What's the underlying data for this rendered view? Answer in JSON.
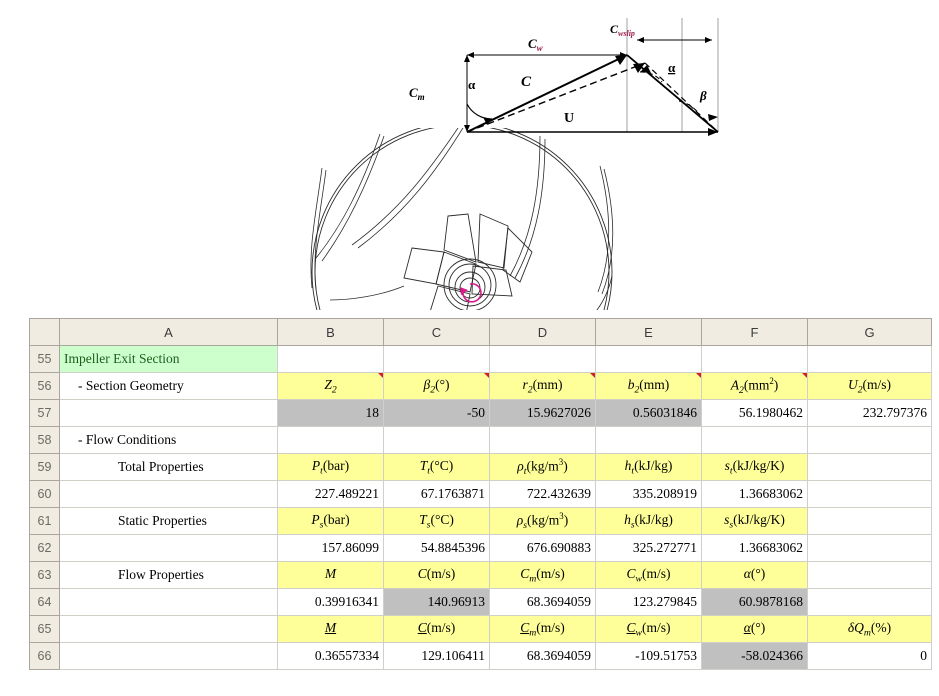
{
  "diagram": {
    "name": "impeller-exit-velocity-triangle",
    "labels": {
      "cw": "C",
      "cw_sub": "w",
      "cwslip": "C",
      "cwslip_sub": "wslip",
      "cm": "C",
      "cm_sub": "m",
      "c": "C",
      "u": "U",
      "alpha": "α",
      "alpha_underlined": "α",
      "beta": "β"
    }
  },
  "spreadsheet": {
    "columns": [
      "A",
      "B",
      "C",
      "D",
      "E",
      "F",
      "G"
    ],
    "rows": [
      {
        "n": "55",
        "a": "Impeller Exit Section",
        "a_fill": "green",
        "cells": [
          "",
          "",
          "",
          "",
          "",
          ""
        ],
        "fill": "white"
      },
      {
        "n": "56",
        "a": "- Section Geometry",
        "a_fill": "white",
        "indent": 1,
        "fill": "yellow",
        "header_row": true,
        "comments": true,
        "cells": [
          {
            "sym": "Z",
            "sub": "2",
            "unit": ""
          },
          {
            "sym": "β",
            "sub": "2",
            "unit": "(°)"
          },
          {
            "sym": "r",
            "sub": "2",
            "unit": "(mm)"
          },
          {
            "sym": "b",
            "sub": "2",
            "unit": "(mm)"
          },
          {
            "sym": "A",
            "sub": "2",
            "unit": "(mm",
            "sup": "2",
            "unit_end": ")"
          },
          {
            "sym": "U",
            "sub": "2",
            "unit": "(m/s)"
          }
        ]
      },
      {
        "n": "57",
        "a": "",
        "values": [
          "18",
          "-50",
          "15.9627026",
          "0.56031846",
          "56.1980462",
          "232.797376"
        ],
        "fills": [
          "grey",
          "grey",
          "grey",
          "grey",
          "white",
          "white"
        ]
      },
      {
        "n": "58",
        "a": "- Flow Conditions",
        "a_fill": "white",
        "indent": 1,
        "values": [
          "",
          "",
          "",
          "",
          "",
          ""
        ],
        "fills": [
          "white",
          "white",
          "white",
          "white",
          "white",
          "white"
        ]
      },
      {
        "n": "59",
        "a": "Total Properties",
        "a_fill": "white",
        "indent": 2,
        "header_row": true,
        "cells": [
          {
            "sym": "P",
            "sub": "t",
            "unit": "(bar)"
          },
          {
            "sym": "T",
            "sub": "t",
            "unit": "(°C)"
          },
          {
            "sym": "ρ",
            "sub": "t",
            "unit": "(kg/m",
            "sup": "3",
            "unit_end": ")"
          },
          {
            "sym": "h",
            "sub": "t",
            "unit": "(kJ/kg)"
          },
          {
            "sym": "s",
            "sub": "t",
            "unit": "(kJ/kg/K)"
          },
          {
            "sym": "",
            "sub": "",
            "unit": ""
          }
        ],
        "fills": [
          "yellow",
          "yellow",
          "yellow",
          "yellow",
          "yellow",
          "white"
        ]
      },
      {
        "n": "60",
        "a": "",
        "values": [
          "227.489221",
          "67.1763871",
          "722.432639",
          "335.208919",
          "1.36683062",
          ""
        ],
        "fills": [
          "white",
          "white",
          "white",
          "white",
          "white",
          "white"
        ]
      },
      {
        "n": "61",
        "a": "Static Properties",
        "a_fill": "white",
        "indent": 2,
        "header_row": true,
        "cells": [
          {
            "sym": "P",
            "sub": "s",
            "unit": "(bar)"
          },
          {
            "sym": "T",
            "sub": "s",
            "unit": "(°C)"
          },
          {
            "sym": "ρ",
            "sub": "s",
            "unit": "(kg/m",
            "sup": "3",
            "unit_end": ")"
          },
          {
            "sym": "h",
            "sub": "s",
            "unit": "(kJ/kg)"
          },
          {
            "sym": "s",
            "sub": "s",
            "unit": "(kJ/kg/K)"
          },
          {
            "sym": "",
            "sub": "",
            "unit": ""
          }
        ],
        "fills": [
          "yellow",
          "yellow",
          "yellow",
          "yellow",
          "yellow",
          "white"
        ]
      },
      {
        "n": "62",
        "a": "",
        "values": [
          "157.86099",
          "54.8845396",
          "676.690883",
          "325.272771",
          "1.36683062",
          ""
        ],
        "fills": [
          "white",
          "white",
          "white",
          "white",
          "white",
          "white"
        ]
      },
      {
        "n": "63",
        "a": "Flow Properties",
        "a_fill": "white",
        "indent": 2,
        "header_row": true,
        "cells": [
          {
            "sym": "M",
            "sub": "",
            "unit": ""
          },
          {
            "sym": "C",
            "sub": "",
            "unit": "(m/s)"
          },
          {
            "sym": "C",
            "sub": "m",
            "unit": "(m/s)"
          },
          {
            "sym": "C",
            "sub": "w",
            "unit": "(m/s)"
          },
          {
            "sym": "α",
            "sub": "",
            "unit": "(°)"
          },
          {
            "sym": "",
            "sub": "",
            "unit": ""
          }
        ],
        "fills": [
          "yellow",
          "yellow",
          "yellow",
          "yellow",
          "yellow",
          "white"
        ]
      },
      {
        "n": "64",
        "a": "",
        "values": [
          "0.39916341",
          "140.96913",
          "68.3694059",
          "123.279845",
          "60.9878168",
          ""
        ],
        "fills": [
          "white",
          "grey",
          "white",
          "white",
          "grey",
          "white"
        ]
      },
      {
        "n": "65",
        "a": "",
        "header_row": true,
        "underline": true,
        "cells": [
          {
            "sym": "M",
            "sub": "",
            "unit": ""
          },
          {
            "sym": "C",
            "sub": "",
            "unit": "(m/s)"
          },
          {
            "sym": "C",
            "sub": "m",
            "unit": "(m/s)"
          },
          {
            "sym": "C",
            "sub": "w",
            "unit": "(m/s)"
          },
          {
            "sym": "α",
            "sub": "",
            "unit": "(°)"
          },
          {
            "sym": "δQ",
            "sub": "m",
            "unit": "(%)"
          }
        ],
        "fills": [
          "yellow",
          "yellow",
          "yellow",
          "yellow",
          "yellow",
          "yellow"
        ]
      },
      {
        "n": "66",
        "a": "",
        "values": [
          "0.36557334",
          "129.106411",
          "68.3694059",
          "-109.51753",
          "-58.024366",
          "0"
        ],
        "fills": [
          "white",
          "white",
          "white",
          "white",
          "grey",
          "white"
        ]
      }
    ]
  },
  "colors": {
    "header_fill": "#f0ece1",
    "yellow": "#ffff99",
    "green": "#ccffcc",
    "grey": "#c0c0c0",
    "grid": "#d0cfc8",
    "comment_marker": "#d42020"
  }
}
